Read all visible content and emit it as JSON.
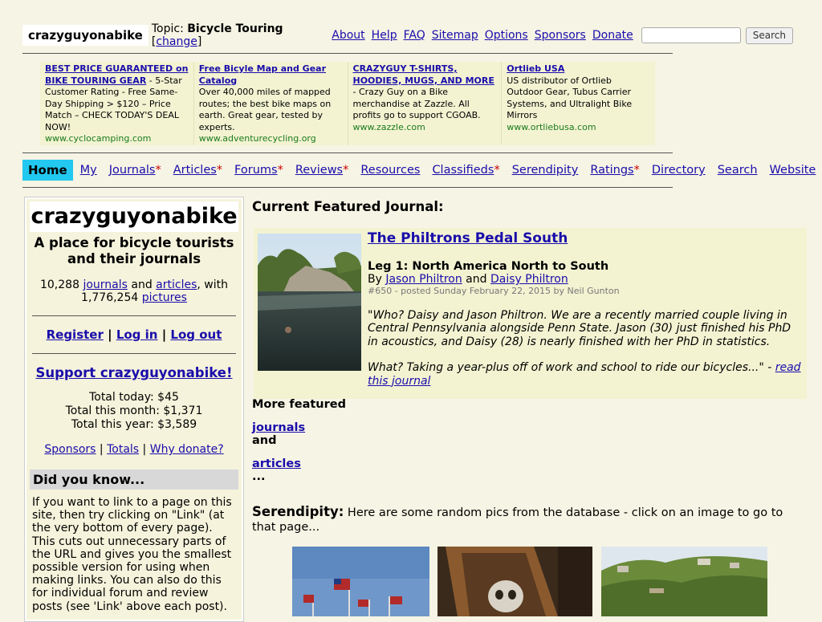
{
  "topbar": {
    "brand": "crazyguyonabike",
    "topic_prefix": "Topic: ",
    "topic": "Bicycle Touring",
    "change_open": " [",
    "change": "change",
    "change_close": "]",
    "links": [
      "About",
      "Help",
      "FAQ",
      "Sitemap",
      "Options",
      "Sponsors",
      "Donate"
    ],
    "search_value": "",
    "search_button": "Search"
  },
  "ads": [
    {
      "title": "BEST PRICE GUARANTEED on BIKE TOURING GEAR",
      "text": " - 5-Star Customer Rating - Free Same-Day Shipping > $120 – Price Match – CHECK TODAY'S DEAL NOW!",
      "url": "www.cyclocamping.com"
    },
    {
      "title": "Free Bicyle Map and Gear Catalog",
      "text": "Over 40,000 miles of mapped routes; the best bike maps on earth. Great gear, tested by experts.",
      "url": "www.adventurecycling.org"
    },
    {
      "title": "CRAZYGUY T-SHIRTS, HOODIES, MUGS, AND MORE",
      "text": " - Crazy Guy on a Bike merchandise at Zazzle. All profits go to support CGOAB.",
      "url": "www.zazzle.com"
    },
    {
      "title": "Ortlieb USA",
      "text": "US distributor of Ortlieb Outdoor Gear, Tubus Carrier Systems, and Ultralight Bike Mirrors",
      "url": "www.ortliebusa.com"
    }
  ],
  "nav": {
    "home": "Home",
    "items": [
      {
        "label": "My",
        "star": ""
      },
      {
        "label": "Journals",
        "star": "*"
      },
      {
        "label": "Articles",
        "star": "*"
      },
      {
        "label": "Forums",
        "star": "*"
      },
      {
        "label": "Reviews",
        "star": "*"
      },
      {
        "label": "Resources",
        "star": ""
      },
      {
        "label": "Classifieds",
        "star": "*"
      },
      {
        "label": "Serendipity",
        "star": ""
      },
      {
        "label": "Ratings",
        "star": "*"
      },
      {
        "label": "Directory",
        "star": ""
      },
      {
        "label": "Search",
        "star": ""
      },
      {
        "label": "Website",
        "star": ""
      }
    ]
  },
  "sidebar": {
    "title": "crazyguyonabike",
    "tagline": "A place for bicycle tourists and their journals",
    "stats": {
      "journals_count": "10,288",
      "journals": "journals",
      "and": " and ",
      "articles": "articles",
      "with": ", with",
      "pictures_count": "1,776,254",
      "pictures": "pictures"
    },
    "register": "Register",
    "login": "Log in",
    "logout": "Log out",
    "sep": " | ",
    "support": "Support crazyguyonabike!",
    "totals": [
      "Total today: $45",
      "Total this month: $1,371",
      "Total this year: $3,589"
    ],
    "bottom_links": [
      "Sponsors",
      "Totals",
      "Why donate?"
    ],
    "did_you_know": "Did you know...",
    "did_you_know_text": "If you want to link to a page on this site, then try clicking on \"Link\" (at the very bottom of every page). This cuts out unnecessary parts of the URL and gives you the smallest possible version for using when making links. You can also do this for individual forum and review posts (see 'Link' above each post)."
  },
  "featured": {
    "heading": "Current Featured Journal:",
    "title": "The Philtrons Pedal South",
    "leg": "Leg 1: North America North to South",
    "by": "By ",
    "author1": "Jason Philtron",
    "and": " and ",
    "author2": "Daisy Philtron",
    "meta": "#650 - posted Sunday February 22, 2015 by Neil Gunton",
    "quote1": "\"Who? Daisy and Jason Philtron. We are a recently married couple living in Central Pennsylvania alongside Penn State. Jason (30) just finished his PhD in acoustics, and Daisy (28) is nearly finished with her PhD in statistics.",
    "quote2": "What? Taking a year-plus off of work and school to ride our bicycles...\"",
    "dash": " - ",
    "read_link": "read this journal"
  },
  "more_featured": {
    "label": "More featured",
    "journals": "journals",
    "and": "and",
    "articles": "articles",
    "ellipsis": "..."
  },
  "serendipity": {
    "label": "Serendipity:",
    "text": " Here are some random pics from the database - click on an image to go to that page..."
  },
  "colors": {
    "background": "#f6f4e4",
    "link": "#1a0dab",
    "home_tab": "#22c8ef",
    "ad_bg": "#f3f3d2",
    "ad_url": "#1b7a1b",
    "star": "#d00000"
  }
}
